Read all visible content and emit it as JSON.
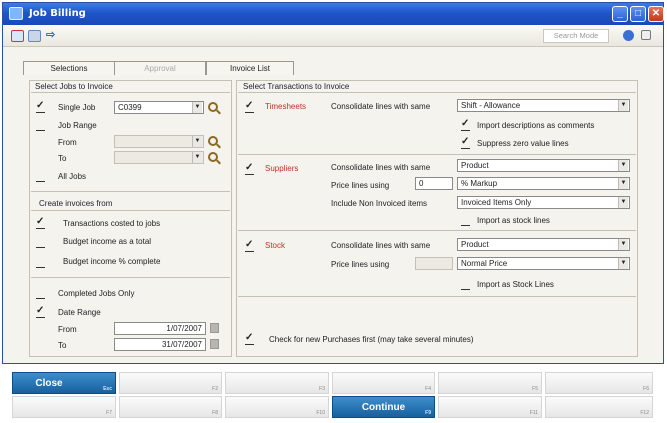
{
  "window": {
    "title": "Job Billing"
  },
  "toolbar": {
    "search_mode": "Search Mode"
  },
  "tabs": [
    {
      "label": "Selections",
      "state": "active"
    },
    {
      "label": "Approval",
      "state": "disabled"
    },
    {
      "label": "Invoice List",
      "state": "normal"
    }
  ],
  "select_jobs": {
    "title": "Select Jobs to Invoice",
    "single_job_label": "Single Job",
    "single_job_value": "C0399",
    "job_range_label": "Job Range",
    "from_label": "From",
    "to_label": "To",
    "all_jobs_label": "All Jobs"
  },
  "create_from": {
    "title": "Create invoices from",
    "transactions_label": "Transactions costed to jobs",
    "budget_total_label": "Budget income as a total",
    "budget_pct_label": "Budget income % complete"
  },
  "completion": {
    "completed_only_label": "Completed Jobs Only",
    "date_range_label": "Date Range",
    "from_label": "From",
    "from_value": "1/07/2007",
    "to_label": "To",
    "to_value": "31/07/2007"
  },
  "select_trans": {
    "title": "Select Transactions to Invoice",
    "timesheets": {
      "label": "Timesheets",
      "consolidate_label": "Consolidate lines with same",
      "consolidate_value": "Shift - Allowance",
      "import_desc_label": "Import descriptions as comments",
      "suppress_zero_label": "Suppress zero value lines"
    },
    "suppliers": {
      "label": "Suppliers",
      "consolidate_label": "Consolidate lines with same",
      "consolidate_value": "Product",
      "price_label": "Price lines using",
      "price_number": "0",
      "price_value": "% Markup",
      "include_label": "Include Non Invoiced items",
      "include_value": "Invoiced Items Only",
      "import_stock_label": "Import as stock lines"
    },
    "stock": {
      "label": "Stock",
      "consolidate_label": "Consolidate lines with same",
      "consolidate_value": "Product",
      "price_label": "Price lines using",
      "price_value": "Normal Price",
      "import_stock_label": "Import as Stock Lines"
    },
    "check_label": "Check for new Purchases first (may take several minutes)"
  },
  "fkeys": {
    "close_label": "Close",
    "close_key": "Esc",
    "continue_label": "Continue",
    "continue_key": "F9"
  },
  "colors": {
    "accent": "#1f55c9",
    "section_red": "#c0322a",
    "fkey_blue": "#17609d"
  }
}
